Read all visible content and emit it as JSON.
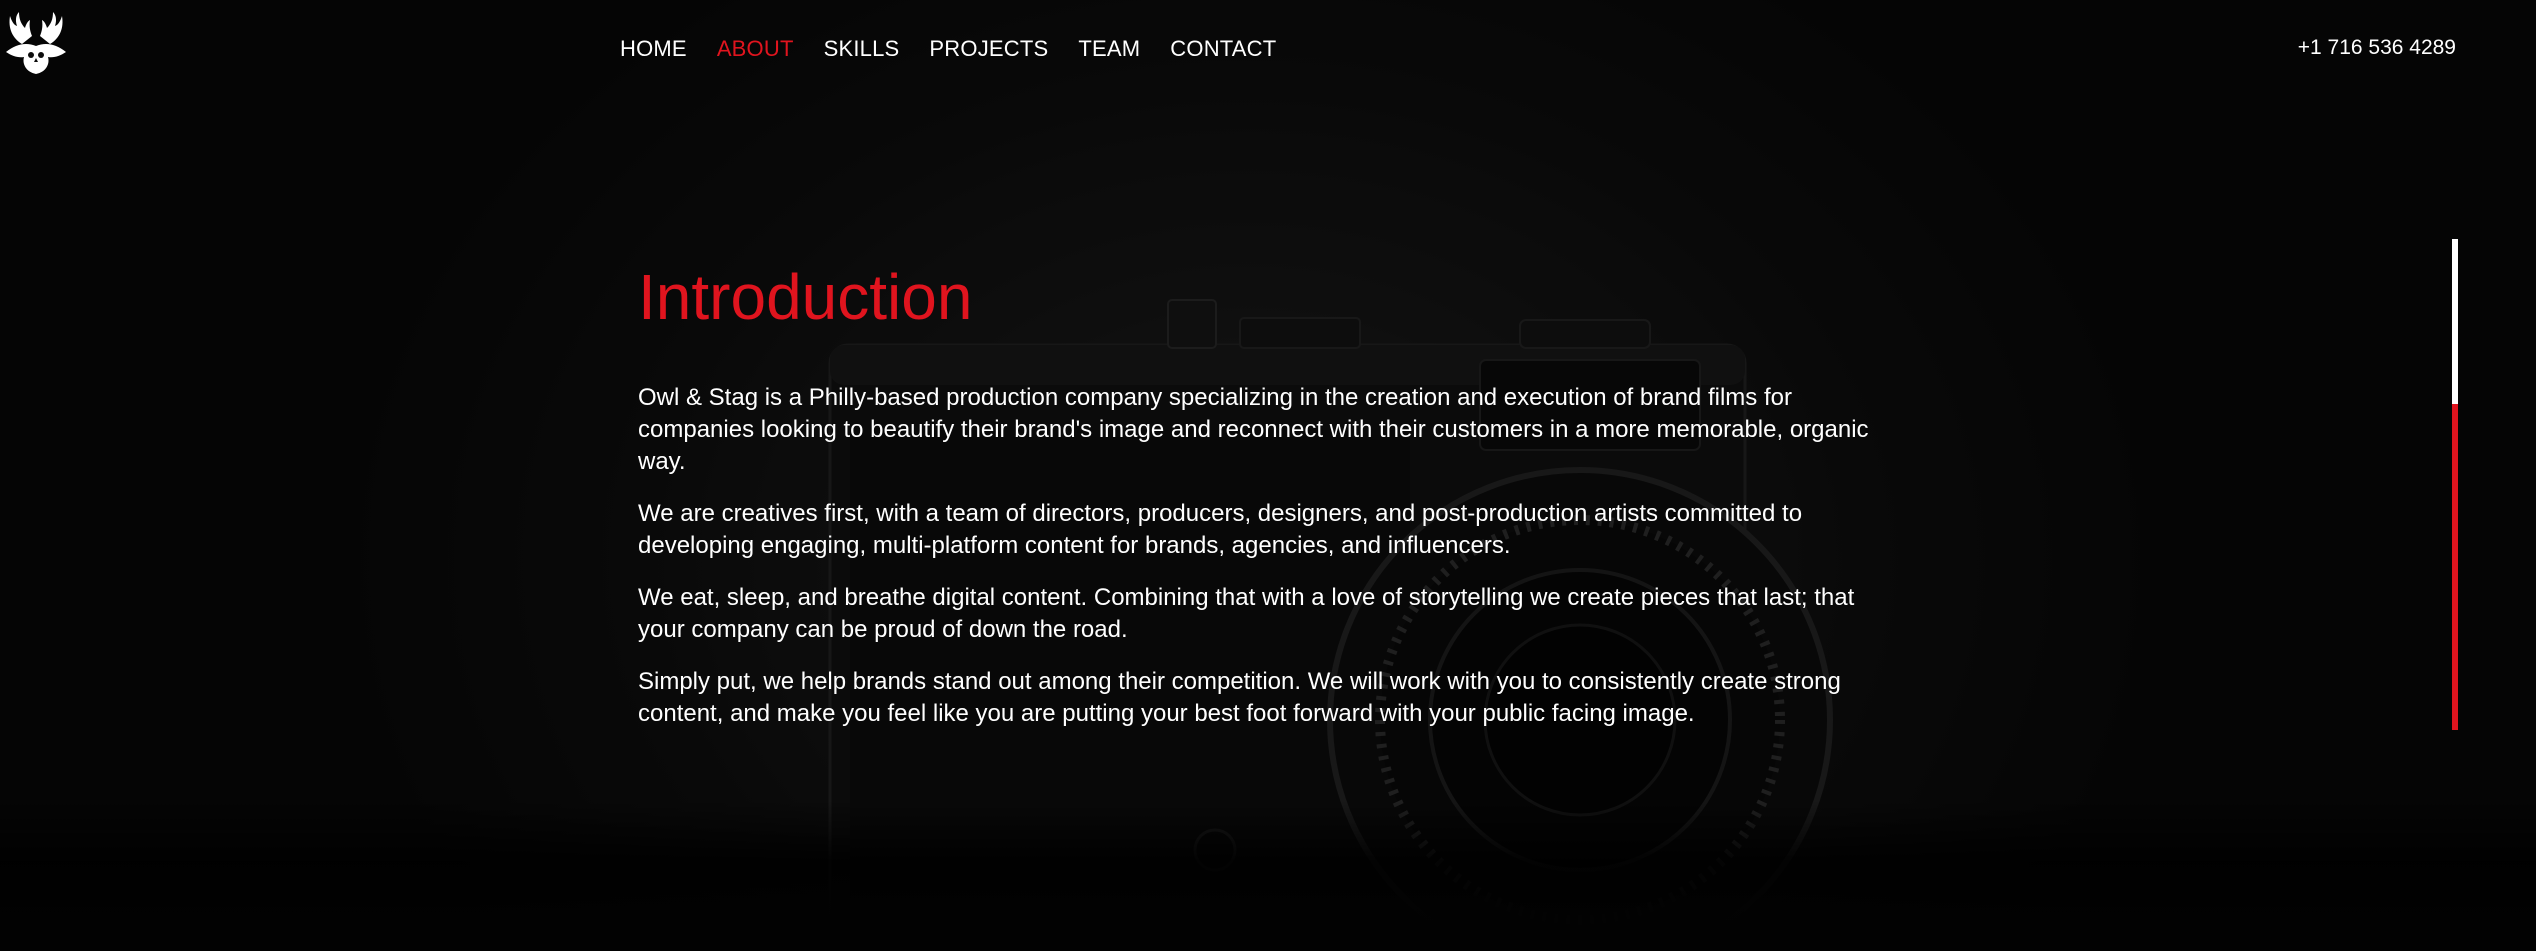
{
  "nav": {
    "items": [
      {
        "label": "HOME",
        "active": false
      },
      {
        "label": "ABOUT",
        "active": true
      },
      {
        "label": "SKILLS",
        "active": false
      },
      {
        "label": "PROJECTS",
        "active": false
      },
      {
        "label": "TEAM",
        "active": false
      },
      {
        "label": "CONTACT",
        "active": false
      }
    ]
  },
  "header": {
    "phone": "+1 716 536 4289",
    "logo_icon": "owl-stag-logo-icon"
  },
  "main": {
    "title": "Introduction",
    "paragraphs": [
      "Owl & Stag is a Philly-based production company specializing in the creation and execution of brand films for companies looking to beautify their brand's image and reconnect with their customers in a more memorable, organic way.",
      "We are creatives first, with a team of directors, producers, designers, and post-production artists committed to developing engaging, multi-platform content for brands, agencies, and influencers.",
      "We eat, sleep, and breathe digital content. Combining that with a love of storytelling we create pieces that last; that your company can be proud of down the road.",
      "Simply put, we help brands stand out among their competition. We will work with you to consistently create strong content, and make you feel like you are putting your best foot forward with your public facing image."
    ]
  },
  "colors": {
    "accent": "#e0141e",
    "text": "#ffffff",
    "background": "#0d0d0d"
  }
}
